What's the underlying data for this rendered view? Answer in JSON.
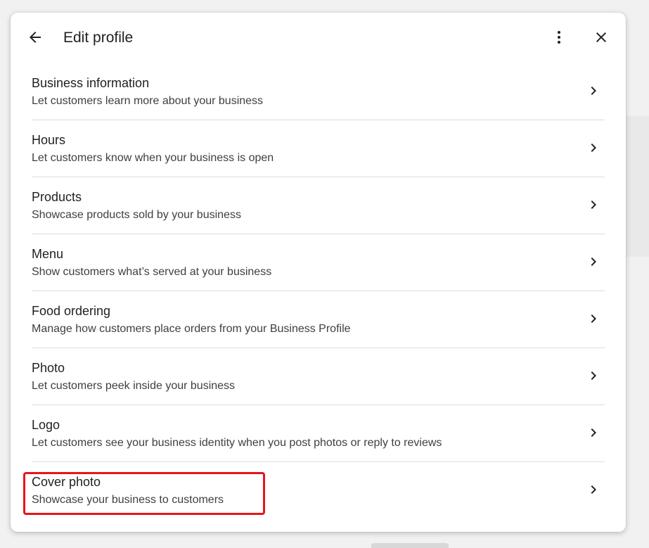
{
  "dialog": {
    "title": "Edit profile",
    "back_icon": "arrow-back-icon",
    "more_icon": "more-vert-icon",
    "close_icon": "close-icon"
  },
  "items": [
    {
      "title": "Business information",
      "subtitle": "Let customers learn more about your business"
    },
    {
      "title": "Hours",
      "subtitle": "Let customers know when your business is open"
    },
    {
      "title": "Products",
      "subtitle": "Showcase products sold by your business"
    },
    {
      "title": "Menu",
      "subtitle": "Show customers what’s served at your business"
    },
    {
      "title": "Food ordering",
      "subtitle": "Manage how customers place orders from your Business Profile"
    },
    {
      "title": "Photo",
      "subtitle": "Let customers peek inside your business"
    },
    {
      "title": "Logo",
      "subtitle": "Let customers see your business identity when you post photos or reply to reviews"
    },
    {
      "title": "Cover photo",
      "subtitle": "Showcase your business to customers"
    }
  ],
  "highlighted_item": "Cover photo",
  "colors": {
    "highlight": "#e8141b",
    "text_primary": "#202124",
    "text_secondary": "#3c4043",
    "divider": "#dadce0"
  }
}
